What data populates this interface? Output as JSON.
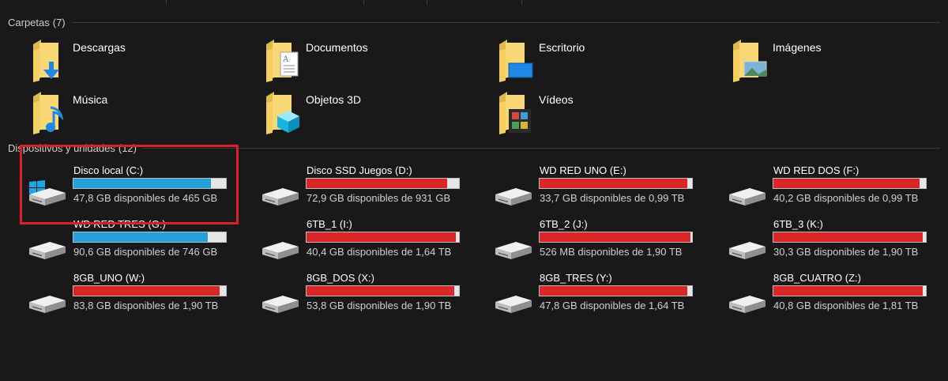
{
  "colors": {
    "background": "#191919",
    "used_normal": "#26a0da",
    "used_critical": "#da2626",
    "bar_free": "#e6e6e6",
    "highlight": "#d6202a",
    "folder_yellow": "#f8d775"
  },
  "folders_group": {
    "title": "Carpetas",
    "count": "(7)",
    "items": [
      {
        "name": "Descargas",
        "icon": "folder-downloads-icon"
      },
      {
        "name": "Documentos",
        "icon": "folder-documents-icon"
      },
      {
        "name": "Escritorio",
        "icon": "folder-desktop-icon"
      },
      {
        "name": "Imágenes",
        "icon": "folder-pictures-icon"
      },
      {
        "name": "Música",
        "icon": "folder-music-icon"
      },
      {
        "name": "Objetos 3D",
        "icon": "folder-3d-objects-icon"
      },
      {
        "name": "Vídeos",
        "icon": "folder-videos-icon"
      }
    ]
  },
  "drives_group": {
    "title": "Dispositivos y unidades",
    "count": "(12)",
    "items": [
      {
        "name": "Disco local (C:)",
        "free": "47,8 GB disponibles de 465 GB",
        "used_pct": 90,
        "status": "normal",
        "icon": "windows-drive-icon"
      },
      {
        "name": "Disco SSD Juegos (D:)",
        "free": "72,9 GB disponibles de 931 GB",
        "used_pct": 92,
        "status": "critical",
        "icon": "hard-drive-icon"
      },
      {
        "name": "WD RED UNO (E:)",
        "free": "33,7 GB disponibles de 0,99 TB",
        "used_pct": 97,
        "status": "critical",
        "icon": "hard-drive-icon"
      },
      {
        "name": "WD RED DOS (F:)",
        "free": "40,2 GB disponibles de 0,99 TB",
        "used_pct": 96,
        "status": "critical",
        "icon": "hard-drive-icon"
      },
      {
        "name": "WD RED TRES (G:)",
        "free": "90,6 GB disponibles de 746 GB",
        "used_pct": 88,
        "status": "normal",
        "icon": "hard-drive-icon"
      },
      {
        "name": "6TB_1 (I:)",
        "free": "40,4 GB disponibles de 1,64 TB",
        "used_pct": 98,
        "status": "critical",
        "icon": "hard-drive-icon"
      },
      {
        "name": "6TB_2 (J:)",
        "free": "526 MB disponibles de 1,90 TB",
        "used_pct": 99,
        "status": "critical",
        "icon": "hard-drive-icon"
      },
      {
        "name": "6TB_3 (K:)",
        "free": "30,3 GB disponibles de 1,90 TB",
        "used_pct": 98,
        "status": "critical",
        "icon": "hard-drive-icon"
      },
      {
        "name": "8GB_UNO (W:)",
        "free": "83,8 GB disponibles de 1,90 TB",
        "used_pct": 96,
        "status": "critical",
        "icon": "hard-drive-icon"
      },
      {
        "name": "8GB_DOS (X:)",
        "free": "53,8 GB disponibles de 1,90 TB",
        "used_pct": 97,
        "status": "critical",
        "icon": "hard-drive-icon"
      },
      {
        "name": "8GB_TRES (Y:)",
        "free": "47,8 GB disponibles de 1,64 TB",
        "used_pct": 97,
        "status": "critical",
        "icon": "hard-drive-icon"
      },
      {
        "name": "8GB_CUATRO (Z:)",
        "free": "40,8 GB disponibles de 1,81 TB",
        "used_pct": 98,
        "status": "critical",
        "icon": "hard-drive-icon"
      }
    ]
  }
}
